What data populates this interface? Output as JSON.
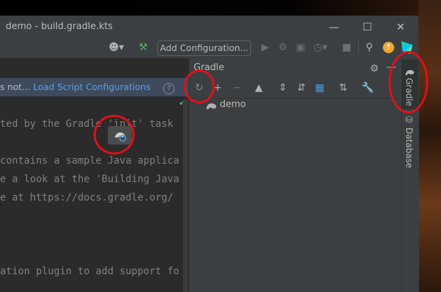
{
  "window": {
    "title": "demo - build.gradle.kts",
    "minimize_icon": "minimize-icon",
    "maximize_icon": "maximize-icon",
    "close_icon": "close-icon"
  },
  "toolbar": {
    "add_config_label": "Add Configuration...",
    "icons": [
      "user-icon",
      "hammer-icon",
      "run-icon",
      "debug-icon",
      "coverage-icon",
      "profile-icon",
      "stop-icon",
      "search-icon",
      "update-icon",
      "logo-icon"
    ]
  },
  "notice": {
    "text": "s not...",
    "link": "Load Script Configurations",
    "help_icon": "help-icon"
  },
  "editor": {
    "lines": [
      "ted by the Gradle 'init' task",
      "",
      "contains a sample Java applica",
      "e a look at the 'Building Java",
      "e at https://docs.gradle.org/",
      "",
      "",
      "",
      "ation plugin to add support fo"
    ]
  },
  "gradle_panel": {
    "title": "Gradle",
    "tree": [
      {
        "label": "demo"
      }
    ]
  },
  "side_tabs": {
    "gradle": "Gradle",
    "database": "Database"
  },
  "colors": {
    "annotation": "#e0101a",
    "link": "#589df6",
    "panel_bg": "#3c3f41",
    "editor_bg": "#2b2b2b"
  }
}
